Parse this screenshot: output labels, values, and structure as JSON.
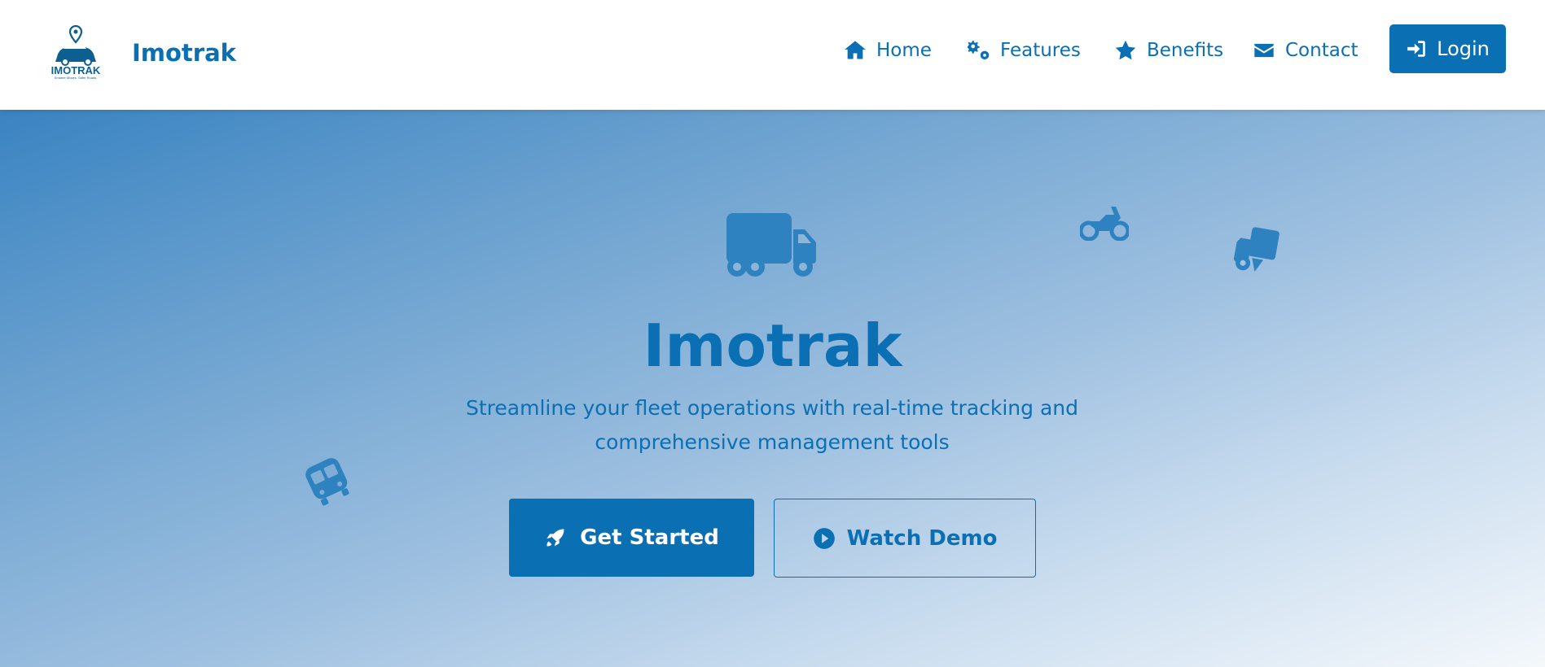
{
  "colors": {
    "accent": "#0b6fb3",
    "deco": "#2f82c0"
  },
  "header": {
    "logo_text": "IMOTRAK",
    "logo_tagline": "Smarter Moves, Safer Roads.",
    "brand": "Imotrak",
    "nav": [
      {
        "label": "Home",
        "icon": "home-icon"
      },
      {
        "label": "Features",
        "icon": "gears-icon"
      },
      {
        "label": "Benefits",
        "icon": "star-icon"
      },
      {
        "label": "Contact",
        "icon": "envelope-icon"
      }
    ],
    "login": {
      "label": "Login",
      "icon": "sign-in-icon"
    }
  },
  "hero": {
    "title": "Imotrak",
    "subtitle": "Streamline your fleet operations with real-time tracking and comprehensive management tools",
    "primary_button": {
      "label": "Get Started",
      "icon": "rocket-icon"
    },
    "secondary_button": {
      "label": "Watch Demo",
      "icon": "play-circle-icon"
    },
    "decorations": [
      "truck-icon",
      "motorcycle-icon",
      "tow-truck-icon",
      "bus-icon"
    ]
  }
}
